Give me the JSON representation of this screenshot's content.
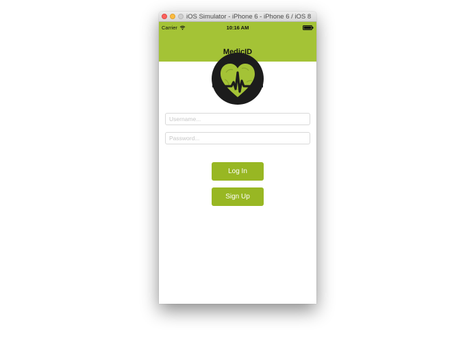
{
  "window": {
    "title": "iOS Simulator - iPhone 6 - iPhone 6 / iOS 8.3..."
  },
  "status_bar": {
    "carrier": "Carrier",
    "time": "10:16 AM",
    "wifi_icon": "wifi-icon",
    "battery_icon": "battery-icon"
  },
  "nav": {
    "title": "MedicID",
    "color": "#a4c336"
  },
  "logo": {
    "icon": "heart-pulse-logo",
    "heart_color": "#a4c336",
    "circle_color": "#1c1c1c"
  },
  "form": {
    "username_placeholder": "Username...",
    "username_value": "",
    "password_placeholder": "Password...",
    "password_value": ""
  },
  "buttons": {
    "login_label": "Log In",
    "signup_label": "Sign Up",
    "color": "#98b723"
  }
}
